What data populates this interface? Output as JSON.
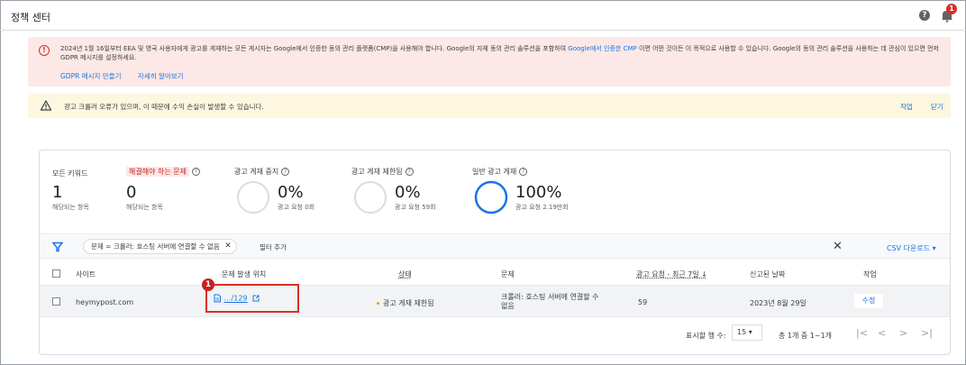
{
  "header": {
    "title": "정책 센터",
    "help_icon": "?",
    "notification_count": "1"
  },
  "gdpr_alert": {
    "message_before": "2024년 1월 16일부터 EEA 및 영국 사용자에게 광고를 게재하는 모든 게시자는 Google에서 인증한 동의 관리 플랫폼(CMP)을 사용해야 합니다. Google의 자체 동의 관리 솔루션을 포함하여 ",
    "message_link": "Google에서 인증한 CMP",
    "message_after": " 이면 어떤 것이든 이 목적으로 사용할 수 있습니다. Google의 동의 관리 솔루션을 사용하는 데 관심이 있으면 먼저 GDPR 메시지를 설정하세요.",
    "action_create": "GDPR 메시지 만들기",
    "action_learn": "자세히 알아보기"
  },
  "crawler_alert": {
    "message": "광고 크롤러 오류가 있으며, 이 때문에 수익 손실이 발생할 수 있습니다.",
    "action": "작업",
    "close": "닫기"
  },
  "stats": {
    "all_keywords": {
      "label": "모든 키워드",
      "value": "1",
      "sub": "해당되는 항목"
    },
    "issues": {
      "label": "해결해야 하는 문제",
      "value": "0",
      "sub": "해당되는 항목"
    },
    "ad_serving_stopped": {
      "label": "광고 게재 중지",
      "percent": "0%",
      "sub": "광고 요청 0회",
      "fraction": 0
    },
    "ad_serving_limited": {
      "label": "광고 게재 제한됨",
      "percent": "0%",
      "sub": "광고 요청 59회",
      "fraction": 0
    },
    "normal_ad_serving": {
      "label": "일반 광고 게재",
      "percent": "100%",
      "sub": "광고 요청 2.19만회",
      "fraction": 1
    }
  },
  "filter": {
    "chip": "문제 = 크롤러: 호스팅 서버에 연결할 수 없음",
    "chip_close": "✕",
    "add": "필터 추가",
    "clear": "✕",
    "csv": "CSV 다운로드 ▾"
  },
  "table": {
    "headers": [
      "사이트",
      "문제 발생 위치",
      "상태",
      "문제",
      "광고 요청 - 최근 7일 ↓",
      "신고된 날짜",
      "작업"
    ],
    "rows": [
      {
        "site": "heymypost.com",
        "location": "…/129",
        "status": "광고 게재 제한됨",
        "issue": "크롤러: 호스팅 서버에 연결할 수 없음",
        "requests": "59",
        "date": "2023년 8월 29일",
        "action": "수정"
      }
    ]
  },
  "annotation": {
    "marker": "1",
    "color": "#d93025"
  },
  "pagination": {
    "rows_label": "표시할 행 수:",
    "rows_value": "15 ▾",
    "count": "총 1개 중 1~1개",
    "first": "|<",
    "prev": "<",
    "next": ">",
    "last": ">|"
  },
  "colors": {
    "accent": "#1a73e8",
    "error": "#d93025",
    "warning": "#f29900"
  }
}
